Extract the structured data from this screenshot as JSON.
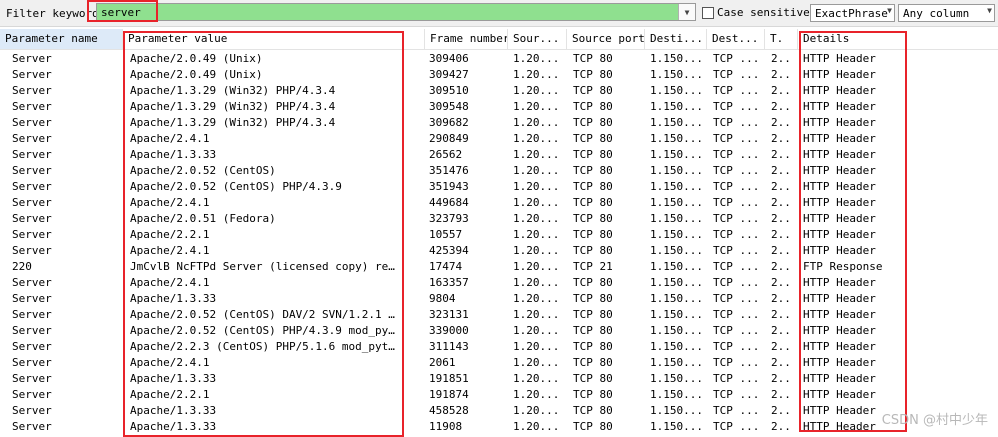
{
  "toolbar": {
    "filter_label": "Filter keyword:",
    "filter_value": "server",
    "case_sensitive_label": "Case sensitive",
    "match_mode": "ExactPhrase",
    "column_scope": "Any column"
  },
  "columns": [
    "Parameter name",
    "Parameter value",
    "Frame number",
    "Sour...",
    "Source port",
    "Desti...",
    "Dest...",
    "T.",
    "Details"
  ],
  "rows": [
    {
      "name": "Server",
      "value": "Apache/2.0.49 (Unix)",
      "frame": "309406",
      "src": "1.20...",
      "sport": "TCP 80",
      "dst": "1.150...",
      "dport": "TCP ...",
      "t": "2..",
      "details": "HTTP Header"
    },
    {
      "name": "Server",
      "value": "Apache/2.0.49 (Unix)",
      "frame": "309427",
      "src": "1.20...",
      "sport": "TCP 80",
      "dst": "1.150...",
      "dport": "TCP ...",
      "t": "2..",
      "details": "HTTP Header"
    },
    {
      "name": "Server",
      "value": "Apache/1.3.29 (Win32) PHP/4.3.4",
      "frame": "309510",
      "src": "1.20...",
      "sport": "TCP 80",
      "dst": "1.150...",
      "dport": "TCP ...",
      "t": "2..",
      "details": "HTTP Header"
    },
    {
      "name": "Server",
      "value": "Apache/1.3.29 (Win32) PHP/4.3.4",
      "frame": "309548",
      "src": "1.20...",
      "sport": "TCP 80",
      "dst": "1.150...",
      "dport": "TCP ...",
      "t": "2..",
      "details": "HTTP Header"
    },
    {
      "name": "Server",
      "value": "Apache/1.3.29 (Win32) PHP/4.3.4",
      "frame": "309682",
      "src": "1.20...",
      "sport": "TCP 80",
      "dst": "1.150...",
      "dport": "TCP ...",
      "t": "2..",
      "details": "HTTP Header"
    },
    {
      "name": "Server",
      "value": "Apache/2.4.1",
      "frame": "290849",
      "src": "1.20...",
      "sport": "TCP 80",
      "dst": "1.150...",
      "dport": "TCP ...",
      "t": "2..",
      "details": "HTTP Header"
    },
    {
      "name": "Server",
      "value": "Apache/1.3.33",
      "frame": "26562",
      "src": "1.20...",
      "sport": "TCP 80",
      "dst": "1.150...",
      "dport": "TCP ...",
      "t": "2..",
      "details": "HTTP Header"
    },
    {
      "name": "Server",
      "value": "Apache/2.0.52 (CentOS)",
      "frame": "351476",
      "src": "1.20...",
      "sport": "TCP 80",
      "dst": "1.150...",
      "dport": "TCP ...",
      "t": "2..",
      "details": "HTTP Header"
    },
    {
      "name": "Server",
      "value": "Apache/2.0.52 (CentOS) PHP/4.3.9",
      "frame": "351943",
      "src": "1.20...",
      "sport": "TCP 80",
      "dst": "1.150...",
      "dport": "TCP ...",
      "t": "2..",
      "details": "HTTP Header"
    },
    {
      "name": "Server",
      "value": "Apache/2.4.1",
      "frame": "449684",
      "src": "1.20...",
      "sport": "TCP 80",
      "dst": "1.150...",
      "dport": "TCP ...",
      "t": "2..",
      "details": "HTTP Header"
    },
    {
      "name": "Server",
      "value": "Apache/2.0.51 (Fedora)",
      "frame": "323793",
      "src": "1.20...",
      "sport": "TCP 80",
      "dst": "1.150...",
      "dport": "TCP ...",
      "t": "2..",
      "details": "HTTP Header"
    },
    {
      "name": "Server",
      "value": "Apache/2.2.1",
      "frame": "10557",
      "src": "1.20...",
      "sport": "TCP 80",
      "dst": "1.150...",
      "dport": "TCP ...",
      "t": "2..",
      "details": "HTTP Header"
    },
    {
      "name": "Server",
      "value": "Apache/2.4.1",
      "frame": "425394",
      "src": "1.20...",
      "sport": "TCP 80",
      "dst": "1.150...",
      "dport": "TCP ...",
      "t": "2..",
      "details": "HTTP Header"
    },
    {
      "name": "220",
      "value": "JmCvlB NcFTPd Server (licensed copy) ready.",
      "frame": "17474",
      "src": "1.20...",
      "sport": "TCP 21",
      "dst": "1.150...",
      "dport": "TCP ...",
      "t": "2..",
      "details": "FTP Response"
    },
    {
      "name": "Server",
      "value": "Apache/2.4.1",
      "frame": "163357",
      "src": "1.20...",
      "sport": "TCP 80",
      "dst": "1.150...",
      "dport": "TCP ...",
      "t": "2..",
      "details": "HTTP Header"
    },
    {
      "name": "Server",
      "value": "Apache/1.3.33",
      "frame": "9804",
      "src": "1.20...",
      "sport": "TCP 80",
      "dst": "1.150...",
      "dport": "TCP ...",
      "t": "2..",
      "details": "HTTP Header"
    },
    {
      "name": "Server",
      "value": "Apache/2.0.52 (CentOS) DAV/2 SVN/1.2.1 PHP/4....",
      "frame": "323131",
      "src": "1.20...",
      "sport": "TCP 80",
      "dst": "1.150...",
      "dport": "TCP ...",
      "t": "2..",
      "details": "HTTP Header"
    },
    {
      "name": "Server",
      "value": "Apache/2.0.52 (CentOS) PHP/4.3.9 mod_python/3....",
      "frame": "339000",
      "src": "1.20...",
      "sport": "TCP 80",
      "dst": "1.150...",
      "dport": "TCP ...",
      "t": "2..",
      "details": "HTTP Header"
    },
    {
      "name": "Server",
      "value": "Apache/2.2.3 (CentOS) PHP/5.1.6 mod_python/3....",
      "frame": "311143",
      "src": "1.20...",
      "sport": "TCP 80",
      "dst": "1.150...",
      "dport": "TCP ...",
      "t": "2..",
      "details": "HTTP Header"
    },
    {
      "name": "Server",
      "value": "Apache/2.4.1",
      "frame": "2061",
      "src": "1.20...",
      "sport": "TCP 80",
      "dst": "1.150...",
      "dport": "TCP ...",
      "t": "2..",
      "details": "HTTP Header"
    },
    {
      "name": "Server",
      "value": "Apache/1.3.33",
      "frame": "191851",
      "src": "1.20...",
      "sport": "TCP 80",
      "dst": "1.150...",
      "dport": "TCP ...",
      "t": "2..",
      "details": "HTTP Header"
    },
    {
      "name": "Server",
      "value": "Apache/2.2.1",
      "frame": "191874",
      "src": "1.20...",
      "sport": "TCP 80",
      "dst": "1.150...",
      "dport": "TCP ...",
      "t": "2..",
      "details": "HTTP Header"
    },
    {
      "name": "Server",
      "value": "Apache/1.3.33",
      "frame": "458528",
      "src": "1.20...",
      "sport": "TCP 80",
      "dst": "1.150...",
      "dport": "TCP ...",
      "t": "2..",
      "details": "HTTP Header"
    },
    {
      "name": "Server",
      "value": "Apache/1.3.33",
      "frame": "11908",
      "src": "1.20...",
      "sport": "TCP 80",
      "dst": "1.150...",
      "dport": "TCP ...",
      "t": "2..",
      "details": "HTTP Header"
    }
  ],
  "watermark": "CSDN @村中少年",
  "colors": {
    "filter_highlight": "#8fe08f",
    "annotation_red": "#e8232a",
    "header_selected": "#ddeaf8"
  }
}
